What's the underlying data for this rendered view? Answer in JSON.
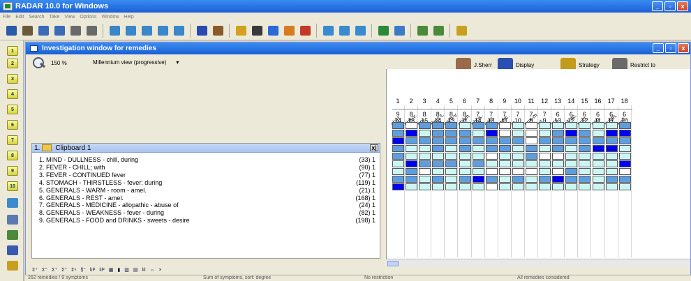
{
  "window": {
    "title": "RADAR 10.0 for Windows"
  },
  "menu": [
    "File",
    "Edit",
    "Search",
    "Take",
    "View",
    "Options",
    "Window",
    "Help"
  ],
  "investigation": {
    "title": "Investigation window for remedies",
    "zoom": "150 %",
    "view": "Millennium view (progressive)",
    "dropdown_arrow": "▾",
    "tools": [
      {
        "label": "J.Sherr",
        "icon": "author-portrait-icon",
        "color": "#9a6a4a"
      },
      {
        "label": "Display",
        "icon": "display-monitor-icon",
        "color": "#2a4fb0"
      },
      {
        "label": "Strategy",
        "icon": "strategy-gears-icon",
        "color": "#c49a1a"
      },
      {
        "label": "Restrict to",
        "icon": "restrict-building-icon",
        "color": "#6a6a6a"
      }
    ]
  },
  "clipboard": {
    "number": "1.",
    "title": "Clipboard 1",
    "close": "x|",
    "rubrics": [
      {
        "text": "1. MIND - DULLNESS - chill, during",
        "count": "(33) 1"
      },
      {
        "text": "2. FEVER - CHILL; with",
        "count": "(90) 1"
      },
      {
        "text": "3. FEVER - CONTINUED fever",
        "count": "(77) 1"
      },
      {
        "text": "4. STOMACH - THIRSTLESS - fever; during",
        "count": "(119) 1"
      },
      {
        "text": "5. GENERALS - WARM - room - amel.",
        "count": "(21) 1"
      },
      {
        "text": "6. GENERALS - REST - amel.",
        "count": "(168) 1"
      },
      {
        "text": "7. GENERALS - MEDICINE - allopathic - abuse of",
        "count": "(24) 1"
      },
      {
        "text": "8. GENERALS - WEAKNESS - fever - during",
        "count": "(82) 1"
      },
      {
        "text": "9. GENERALS - FOOD and DRINKS - sweets - desire",
        "count": "(198) 1"
      }
    ]
  },
  "remedies": [
    {
      "name": "chin.",
      "rank": "1",
      "score": "9",
      "count": "14"
    },
    {
      "name": "nux-v.",
      "rank": "2",
      "score": "8",
      "count": "18"
    },
    {
      "name": "bry.",
      "rank": "3",
      "score": "8",
      "count": "15"
    },
    {
      "name": "rhus-t.",
      "rank": "4",
      "score": "8",
      "count": "14"
    },
    {
      "name": "carb-v.",
      "rank": "5",
      "score": "8",
      "count": "13"
    },
    {
      "name": "cham.",
      "rank": "6",
      "score": "8",
      "count": "11"
    },
    {
      "name": "phos.",
      "rank": "7",
      "score": "7",
      "count": "14"
    },
    {
      "name": "calc.",
      "rank": "8",
      "score": "7",
      "count": "13"
    },
    {
      "name": "merc.",
      "rank": "9",
      "score": "7",
      "count": "11"
    },
    {
      "name": "ip.",
      "rank": "10",
      "score": "7",
      "count": "10"
    },
    {
      "name": "nux-m.",
      "rank": "11",
      "score": "7",
      "count": "9"
    },
    {
      "name": "sil.",
      "rank": "12",
      "score": "7",
      "count": "9"
    },
    {
      "name": "ars.",
      "rank": "13",
      "score": "6",
      "count": "13"
    },
    {
      "name": "nit-ac.",
      "rank": "14",
      "score": "6",
      "count": "12"
    },
    {
      "name": "puls.",
      "rank": "15",
      "score": "6",
      "count": "12"
    },
    {
      "name": "sep.",
      "rank": "16",
      "score": "6",
      "count": "11"
    },
    {
      "name": "sulph.",
      "rank": "17",
      "score": "6",
      "count": "11"
    },
    {
      "name": "bell.",
      "rank": "18",
      "score": "6",
      "count": "10"
    }
  ],
  "grades": [
    [
      2,
      0,
      2,
      2,
      2,
      1,
      2,
      2,
      0,
      1,
      0,
      1,
      1,
      1,
      1,
      1,
      1,
      2
    ],
    [
      2,
      3,
      1,
      2,
      2,
      2,
      1,
      3,
      0,
      1,
      0,
      1,
      2,
      3,
      2,
      1,
      3,
      3
    ],
    [
      3,
      2,
      2,
      2,
      2,
      2,
      2,
      2,
      2,
      2,
      0,
      2,
      2,
      2,
      2,
      2,
      2,
      2
    ],
    [
      2,
      1,
      1,
      2,
      1,
      2,
      1,
      2,
      2,
      1,
      2,
      1,
      2,
      1,
      2,
      3,
      3,
      1
    ],
    [
      2,
      1,
      1,
      1,
      1,
      1,
      1,
      0,
      1,
      1,
      2,
      0,
      0,
      1,
      1,
      1,
      1,
      1
    ],
    [
      1,
      3,
      2,
      2,
      2,
      1,
      2,
      1,
      1,
      1,
      1,
      1,
      1,
      1,
      1,
      1,
      1,
      3
    ],
    [
      1,
      2,
      0,
      1,
      1,
      1,
      1,
      0,
      0,
      0,
      0,
      1,
      0,
      2,
      1,
      1,
      1,
      0
    ],
    [
      2,
      2,
      1,
      2,
      1,
      2,
      3,
      2,
      1,
      2,
      1,
      2,
      3,
      2,
      2,
      1,
      2,
      2
    ],
    [
      3,
      1,
      1,
      1,
      1,
      1,
      1,
      0,
      1,
      1,
      1,
      1,
      1,
      1,
      1,
      1,
      1,
      1
    ]
  ],
  "grade_colors": [
    "#ffffff",
    "#ccf6f4",
    "#5f9ede",
    "#0000f0"
  ],
  "bottom_toolbar": [
    "Σ⁺",
    "Σ⁼",
    "Σ⁺",
    "Σ⁼",
    "Σ⁶",
    "§⁼",
    "lıl²",
    "lıl²",
    "▦",
    "▮",
    "▥",
    "▤",
    "lıl",
    "⇔",
    "×"
  ],
  "status": {
    "remedies": "262 remedies / 9 symptoms",
    "sort": "Sum of symptoms, sort: degree",
    "restriction": "No restriction",
    "considered": "All remedies considered"
  }
}
